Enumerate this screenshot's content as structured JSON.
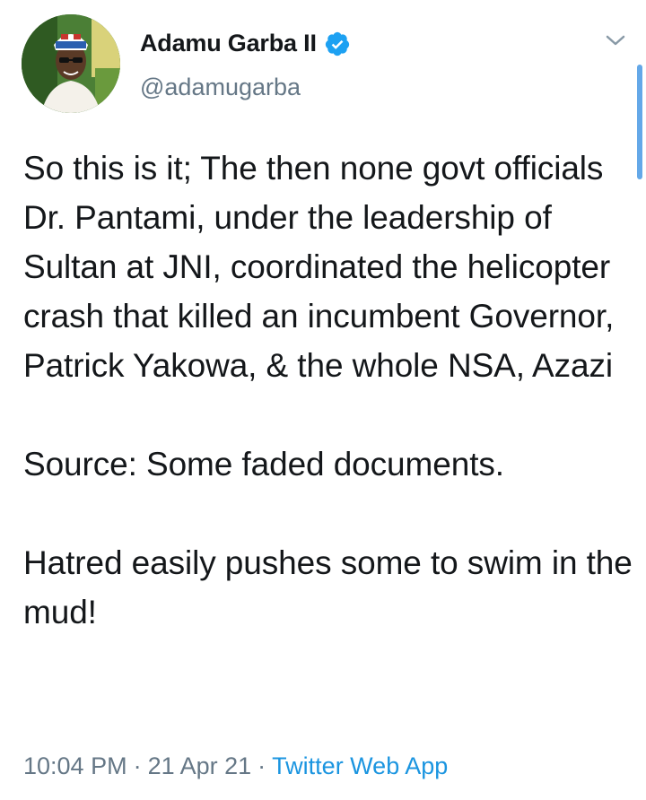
{
  "tweet": {
    "author": {
      "display_name": "Adamu Garba II",
      "handle": "@adamugarba",
      "verified": true,
      "avatar_icon": "profile-photo"
    },
    "paragraphs": [
      "So this is it; The then none govt officials Dr. Pantami, under the leadership of Sultan at JNI, coordinated the helicopter crash that killed an incumbent Governor, Patrick Yakowa, & the whole NSA, Azazi",
      "Source: Some faded documents.",
      "Hatred easily pushes some to swim in the mud!"
    ],
    "time": "10:04 PM",
    "date": "21 Apr 21",
    "separator": "·",
    "source_app": "Twitter Web App"
  },
  "colors": {
    "text": "#14171a",
    "muted": "#657786",
    "link": "#1b95e0",
    "verified": "#1da1f2",
    "scrollbar": "#64a8e8"
  }
}
